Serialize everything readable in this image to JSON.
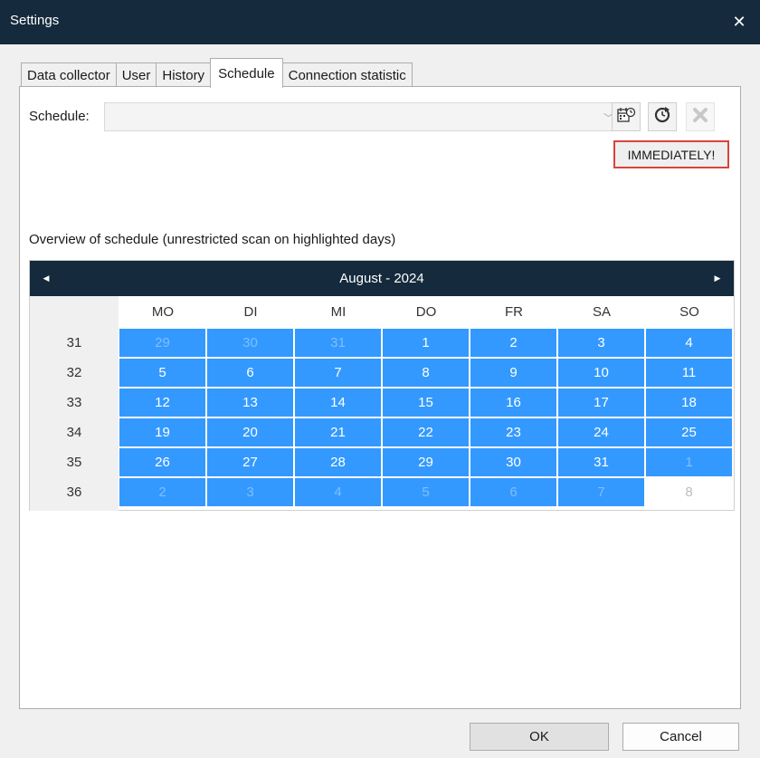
{
  "window": {
    "title": "Settings",
    "close_glyph": "✕"
  },
  "tabs": [
    {
      "label": "Data collector",
      "active": false
    },
    {
      "label": "User",
      "active": false
    },
    {
      "label": "History",
      "active": false
    },
    {
      "label": "Schedule",
      "active": true
    },
    {
      "label": "Connection statistic",
      "active": false
    }
  ],
  "schedule": {
    "label": "Schedule:",
    "value": "",
    "icons": [
      "schedule-settings-icon",
      "schedule-refresh-icon",
      "delete-icon"
    ],
    "immediately_label": "IMMEDIATELY!"
  },
  "overview": {
    "label": "Overview of schedule (unrestricted scan on highlighted days)"
  },
  "calendar": {
    "month_label": "August - 2024",
    "prev_glyph": "◀",
    "next_glyph": "▶",
    "weekdays": [
      "MO",
      "DI",
      "MI",
      "DO",
      "FR",
      "SA",
      "SO"
    ],
    "weeks": [
      {
        "number": "31",
        "days": [
          {
            "day": "29",
            "other_month": true,
            "highlighted": true
          },
          {
            "day": "30",
            "other_month": true,
            "highlighted": true
          },
          {
            "day": "31",
            "other_month": true,
            "highlighted": true
          },
          {
            "day": "1",
            "other_month": false,
            "highlighted": true
          },
          {
            "day": "2",
            "other_month": false,
            "highlighted": true
          },
          {
            "day": "3",
            "other_month": false,
            "highlighted": true
          },
          {
            "day": "4",
            "other_month": false,
            "highlighted": true
          }
        ]
      },
      {
        "number": "32",
        "days": [
          {
            "day": "5",
            "other_month": false,
            "highlighted": true
          },
          {
            "day": "6",
            "other_month": false,
            "highlighted": true
          },
          {
            "day": "7",
            "other_month": false,
            "highlighted": true
          },
          {
            "day": "8",
            "other_month": false,
            "highlighted": true
          },
          {
            "day": "9",
            "other_month": false,
            "highlighted": true
          },
          {
            "day": "10",
            "other_month": false,
            "highlighted": true
          },
          {
            "day": "11",
            "other_month": false,
            "highlighted": true
          }
        ]
      },
      {
        "number": "33",
        "days": [
          {
            "day": "12",
            "other_month": false,
            "highlighted": true
          },
          {
            "day": "13",
            "other_month": false,
            "highlighted": true
          },
          {
            "day": "14",
            "other_month": false,
            "highlighted": true
          },
          {
            "day": "15",
            "other_month": false,
            "highlighted": true
          },
          {
            "day": "16",
            "other_month": false,
            "highlighted": true
          },
          {
            "day": "17",
            "other_month": false,
            "highlighted": true
          },
          {
            "day": "18",
            "other_month": false,
            "highlighted": true
          }
        ]
      },
      {
        "number": "34",
        "days": [
          {
            "day": "19",
            "other_month": false,
            "highlighted": true
          },
          {
            "day": "20",
            "other_month": false,
            "highlighted": true
          },
          {
            "day": "21",
            "other_month": false,
            "highlighted": true
          },
          {
            "day": "22",
            "other_month": false,
            "highlighted": true
          },
          {
            "day": "23",
            "other_month": false,
            "highlighted": true
          },
          {
            "day": "24",
            "other_month": false,
            "highlighted": true
          },
          {
            "day": "25",
            "other_month": false,
            "highlighted": true
          }
        ]
      },
      {
        "number": "35",
        "days": [
          {
            "day": "26",
            "other_month": false,
            "highlighted": true
          },
          {
            "day": "27",
            "other_month": false,
            "highlighted": true
          },
          {
            "day": "28",
            "other_month": false,
            "highlighted": true
          },
          {
            "day": "29",
            "other_month": false,
            "highlighted": true
          },
          {
            "day": "30",
            "other_month": false,
            "highlighted": true
          },
          {
            "day": "31",
            "other_month": false,
            "highlighted": true
          },
          {
            "day": "1",
            "other_month": true,
            "highlighted": true
          }
        ]
      },
      {
        "number": "36",
        "days": [
          {
            "day": "2",
            "other_month": true,
            "highlighted": true
          },
          {
            "day": "3",
            "other_month": true,
            "highlighted": true
          },
          {
            "day": "4",
            "other_month": true,
            "highlighted": true
          },
          {
            "day": "5",
            "other_month": true,
            "highlighted": true
          },
          {
            "day": "6",
            "other_month": true,
            "highlighted": true
          },
          {
            "day": "7",
            "other_month": true,
            "highlighted": true
          },
          {
            "day": "8",
            "other_month": true,
            "highlighted": false
          }
        ]
      }
    ]
  },
  "buttons": {
    "ok": "OK",
    "cancel": "Cancel"
  },
  "colors": {
    "titlebar": "#152a3c",
    "highlight": "#3399ff",
    "accent_border": "#d9443a"
  }
}
